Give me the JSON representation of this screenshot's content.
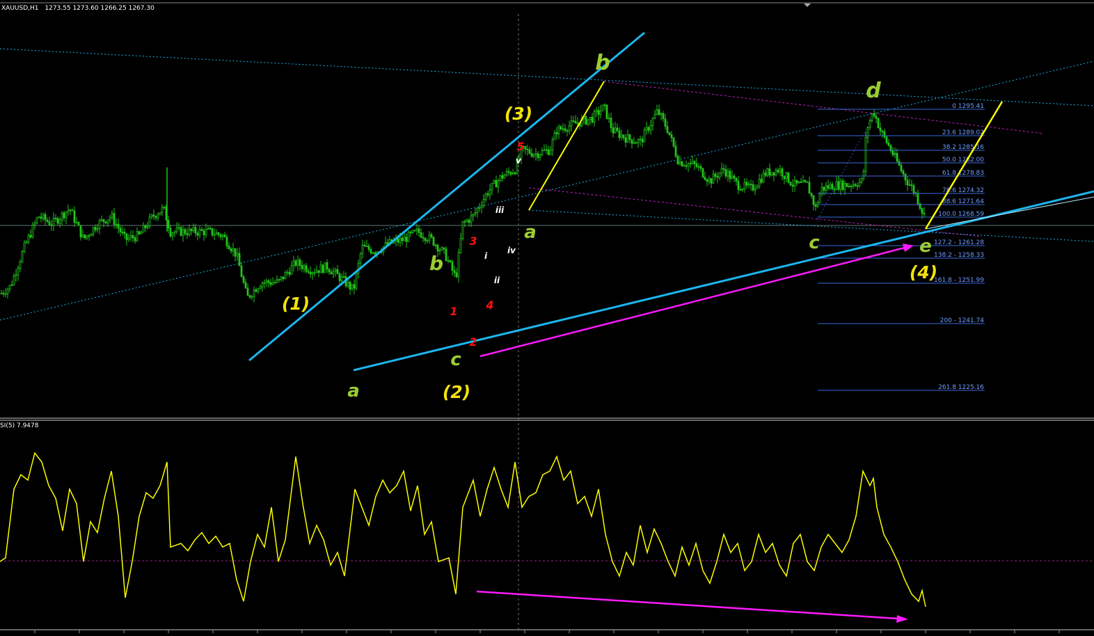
{
  "header": {
    "symbol": "XAUUSD,H1",
    "ohlc": "1273.55 1273.60 1266.25 1267.30"
  },
  "indicator": {
    "label": "SI(5) 7.9478"
  },
  "colors": {
    "background": "#000000",
    "candles": "#22c41a",
    "rsi": "#ffff00",
    "trend_blue": "#1cb6ee",
    "trend_yellow": "#ffff00",
    "arrow_magenta": "#ff1aff",
    "fib_lines": "#3a6adc",
    "fib_text": "#6f9dff",
    "label_green": "#9acd32",
    "label_yellow": "#f2e20a",
    "label_red": "#ff1010",
    "label_white": "#ffffff"
  },
  "fibonacci": [
    {
      "text": "0 1295.41"
    },
    {
      "text": "23.6 1289.02"
    },
    {
      "text": "38.2 1285.16"
    },
    {
      "text": "50.0 1282.00"
    },
    {
      "text": "61.8 1278.83"
    },
    {
      "text": "78.6 1274.32"
    },
    {
      "text": "88.6 1271.64"
    },
    {
      "text": "100.0 1268.59"
    },
    {
      "text": "127.2 - 1261.28"
    },
    {
      "text": "138.2 - 1258.33"
    },
    {
      "text": "161.8 - 1251.99"
    },
    {
      "text": "200 - 1241.74"
    },
    {
      "text": "261.8 1225.16"
    }
  ],
  "wave_labels": [
    {
      "text": "(1)",
      "color": "yellow"
    },
    {
      "text": "(2)",
      "color": "yellow"
    },
    {
      "text": "(3)",
      "color": "yellow"
    },
    {
      "text": "(4)",
      "color": "yellow"
    },
    {
      "text": "a",
      "color": "green"
    },
    {
      "text": "b",
      "color": "green"
    },
    {
      "text": "c",
      "color": "green"
    },
    {
      "text": "a",
      "color": "green"
    },
    {
      "text": "b",
      "color": "green"
    },
    {
      "text": "c",
      "color": "green"
    },
    {
      "text": "d",
      "color": "green"
    },
    {
      "text": "e",
      "color": "green"
    },
    {
      "text": "1",
      "color": "red"
    },
    {
      "text": "2",
      "color": "red"
    },
    {
      "text": "3",
      "color": "red"
    },
    {
      "text": "4",
      "color": "red"
    },
    {
      "text": "5",
      "color": "red"
    },
    {
      "text": "i",
      "color": "white"
    },
    {
      "text": "ii",
      "color": "white"
    },
    {
      "text": "iii",
      "color": "white"
    },
    {
      "text": "iv",
      "color": "white"
    },
    {
      "text": "v",
      "color": "white"
    }
  ],
  "chart_data": [
    {
      "type": "candlestick",
      "title": "XAUUSD,H1",
      "ohlc_last": {
        "open": 1273.55,
        "high": 1273.6,
        "low": 1266.25,
        "close": 1267.3
      },
      "ylim": [
        1220,
        1300
      ],
      "grid": false,
      "price_path": [
        [
          0,
          1248
        ],
        [
          15,
          1250
        ],
        [
          35,
          1260
        ],
        [
          55,
          1268
        ],
        [
          75,
          1266
        ],
        [
          100,
          1270
        ],
        [
          120,
          1262
        ],
        [
          140,
          1266
        ],
        [
          160,
          1268
        ],
        [
          180,
          1262
        ],
        [
          200,
          1263
        ],
        [
          220,
          1268
        ],
        [
          235,
          1270
        ],
        [
          245,
          1264
        ],
        [
          270,
          1264
        ],
        [
          300,
          1264
        ],
        [
          320,
          1263
        ],
        [
          340,
          1258
        ],
        [
          355,
          1247
        ],
        [
          375,
          1251
        ],
        [
          400,
          1251
        ],
        [
          425,
          1256
        ],
        [
          450,
          1254
        ],
        [
          470,
          1255
        ],
        [
          490,
          1252
        ],
        [
          508,
          1249
        ],
        [
          520,
          1260
        ],
        [
          540,
          1259
        ],
        [
          560,
          1261
        ],
        [
          580,
          1262
        ],
        [
          600,
          1264
        ],
        [
          620,
          1262
        ],
        [
          640,
          1258
        ],
        [
          655,
          1252
        ],
        [
          665,
          1266
        ],
        [
          680,
          1268
        ],
        [
          700,
          1274
        ],
        [
          720,
          1278
        ],
        [
          740,
          1280
        ],
        [
          750,
          1285
        ],
        [
          770,
          1284
        ],
        [
          790,
          1285
        ],
        [
          800,
          1290
        ],
        [
          830,
          1292
        ],
        [
          850,
          1293
        ],
        [
          868,
          1296
        ],
        [
          880,
          1290
        ],
        [
          900,
          1288
        ],
        [
          920,
          1287
        ],
        [
          945,
          1295
        ],
        [
          960,
          1290
        ],
        [
          975,
          1282
        ],
        [
          1000,
          1281
        ],
        [
          1020,
          1277
        ],
        [
          1040,
          1280
        ],
        [
          1060,
          1276
        ],
        [
          1080,
          1275
        ],
        [
          1100,
          1279
        ],
        [
          1120,
          1280
        ],
        [
          1140,
          1276
        ],
        [
          1160,
          1276
        ],
        [
          1172,
          1270
        ],
        [
          1180,
          1275
        ],
        [
          1200,
          1276
        ],
        [
          1220,
          1276
        ],
        [
          1240,
          1277
        ],
        [
          1245,
          1290
        ],
        [
          1255,
          1295
        ],
        [
          1265,
          1290
        ],
        [
          1280,
          1285
        ],
        [
          1300,
          1278
        ],
        [
          1315,
          1274
        ],
        [
          1328,
          1268
        ]
      ],
      "rsi": [
        [
          0,
          30
        ],
        [
          8,
          32
        ],
        [
          20,
          70
        ],
        [
          30,
          78
        ],
        [
          40,
          75
        ],
        [
          50,
          90
        ],
        [
          60,
          85
        ],
        [
          70,
          72
        ],
        [
          80,
          65
        ],
        [
          90,
          47
        ],
        [
          100,
          70
        ],
        [
          110,
          62
        ],
        [
          120,
          30
        ],
        [
          130,
          52
        ],
        [
          140,
          46
        ],
        [
          150,
          65
        ],
        [
          160,
          80
        ],
        [
          170,
          55
        ],
        [
          180,
          10
        ],
        [
          190,
          30
        ],
        [
          200,
          55
        ],
        [
          210,
          68
        ],
        [
          220,
          65
        ],
        [
          230,
          72
        ],
        [
          240,
          85
        ],
        [
          245,
          38
        ],
        [
          260,
          40
        ],
        [
          270,
          36
        ],
        [
          280,
          42
        ],
        [
          290,
          46
        ],
        [
          300,
          40
        ],
        [
          310,
          44
        ],
        [
          320,
          38
        ],
        [
          330,
          40
        ],
        [
          340,
          20
        ],
        [
          350,
          8
        ],
        [
          360,
          30
        ],
        [
          370,
          45
        ],
        [
          380,
          38
        ],
        [
          390,
          60
        ],
        [
          400,
          30
        ],
        [
          410,
          42
        ],
        [
          425,
          88
        ],
        [
          435,
          62
        ],
        [
          445,
          40
        ],
        [
          455,
          50
        ],
        [
          465,
          42
        ],
        [
          475,
          28
        ],
        [
          485,
          35
        ],
        [
          495,
          22
        ],
        [
          510,
          70
        ],
        [
          520,
          60
        ],
        [
          530,
          50
        ],
        [
          540,
          66
        ],
        [
          550,
          75
        ],
        [
          560,
          68
        ],
        [
          570,
          72
        ],
        [
          580,
          80
        ],
        [
          590,
          58
        ],
        [
          600,
          72
        ],
        [
          610,
          45
        ],
        [
          620,
          52
        ],
        [
          630,
          30
        ],
        [
          645,
          32
        ],
        [
          655,
          12
        ],
        [
          665,
          60
        ],
        [
          680,
          75
        ],
        [
          690,
          55
        ],
        [
          700,
          70
        ],
        [
          710,
          82
        ],
        [
          720,
          70
        ],
        [
          730,
          60
        ],
        [
          740,
          85
        ],
        [
          750,
          60
        ],
        [
          760,
          66
        ],
        [
          770,
          68
        ],
        [
          780,
          78
        ],
        [
          790,
          80
        ],
        [
          800,
          88
        ],
        [
          810,
          75
        ],
        [
          820,
          80
        ],
        [
          830,
          62
        ],
        [
          840,
          66
        ],
        [
          850,
          55
        ],
        [
          860,
          70
        ],
        [
          870,
          45
        ],
        [
          880,
          30
        ],
        [
          890,
          22
        ],
        [
          900,
          35
        ],
        [
          910,
          28
        ],
        [
          920,
          50
        ],
        [
          930,
          35
        ],
        [
          940,
          48
        ],
        [
          950,
          40
        ],
        [
          960,
          30
        ],
        [
          970,
          22
        ],
        [
          980,
          38
        ],
        [
          990,
          28
        ],
        [
          1000,
          40
        ],
        [
          1010,
          25
        ],
        [
          1020,
          18
        ],
        [
          1030,
          30
        ],
        [
          1040,
          45
        ],
        [
          1050,
          35
        ],
        [
          1060,
          40
        ],
        [
          1070,
          25
        ],
        [
          1080,
          30
        ],
        [
          1090,
          45
        ],
        [
          1100,
          35
        ],
        [
          1110,
          40
        ],
        [
          1120,
          28
        ],
        [
          1130,
          22
        ],
        [
          1140,
          40
        ],
        [
          1150,
          45
        ],
        [
          1160,
          30
        ],
        [
          1170,
          25
        ],
        [
          1180,
          38
        ],
        [
          1190,
          45
        ],
        [
          1200,
          40
        ],
        [
          1210,
          35
        ],
        [
          1220,
          42
        ],
        [
          1230,
          55
        ],
        [
          1240,
          80
        ],
        [
          1250,
          72
        ],
        [
          1255,
          76
        ],
        [
          1260,
          60
        ],
        [
          1270,
          45
        ],
        [
          1280,
          38
        ],
        [
          1290,
          30
        ],
        [
          1300,
          20
        ],
        [
          1310,
          12
        ],
        [
          1320,
          8
        ],
        [
          1325,
          14
        ],
        [
          1330,
          5
        ]
      ]
    }
  ]
}
